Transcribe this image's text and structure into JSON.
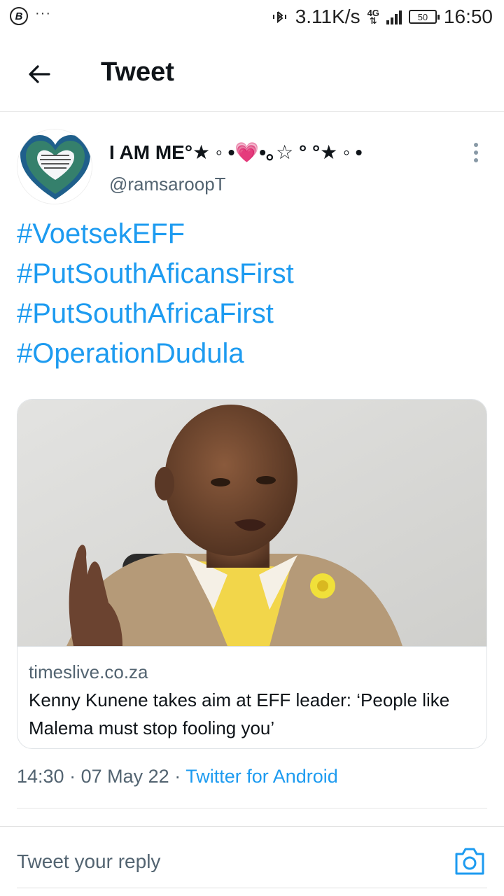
{
  "status_bar": {
    "left_icon": "B",
    "left_dots": "···",
    "network_speed": "3.11K/s",
    "network_type": "4G",
    "battery": "50",
    "time": "16:50"
  },
  "header": {
    "title": "Tweet"
  },
  "tweet": {
    "display_name": "I AM ME°★ ◦ •💗•｡☆ ° °★ ◦ •",
    "handle": "@ramsaroopT",
    "hashtags": [
      "#VoetsekEFF",
      "#PutSouthAficansFirst",
      "#PutSouthAfricaFirst",
      "#OperationDudula"
    ],
    "card": {
      "domain": "timeslive.co.za",
      "title": "Kenny Kunene takes aim at EFF leader: ‘People like Malema must stop fooling you’"
    },
    "time": "14:30",
    "separator": "·",
    "date": "07 May 22",
    "source": "Twitter for Android"
  },
  "reply": {
    "placeholder": "Tweet your reply"
  },
  "colors": {
    "link_blue": "#1d9bf0",
    "secondary_text": "#536471",
    "primary_text": "#0f1419"
  },
  "icons": [
    "b-circle-icon",
    "bluetooth-vibrate-icon",
    "signal-icon",
    "battery-icon",
    "back-arrow-icon",
    "more-vertical-icon",
    "camera-icon"
  ]
}
